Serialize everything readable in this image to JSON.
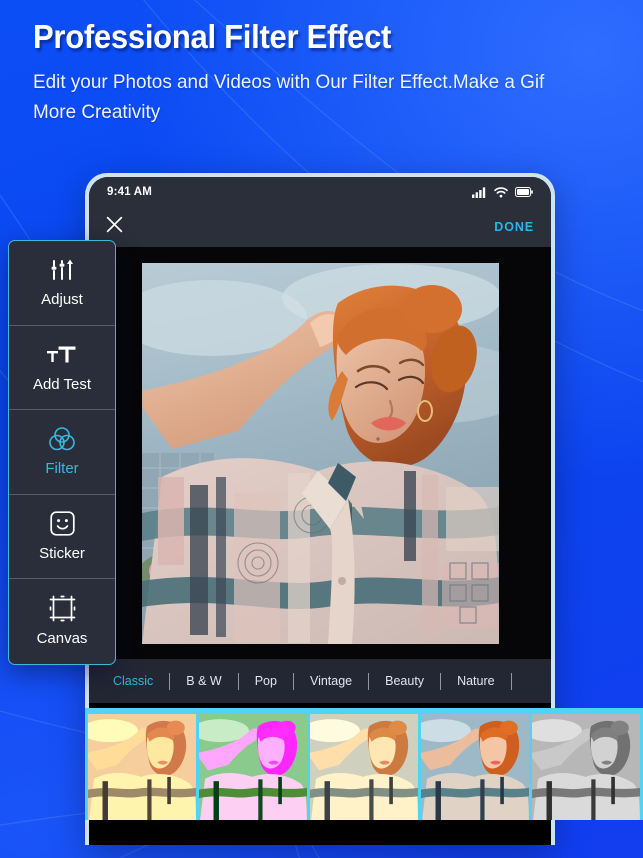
{
  "promo": {
    "title": "Professional Filter Effect",
    "subtitle": "Edit your Photos and Videos with Our Filter Effect.Make a Gif More Creativity",
    "background_color": "#0b4df5",
    "accent_color": "#51d3f5"
  },
  "phone": {
    "status_bar": {
      "time": "9:41 AM",
      "icons": [
        "cellular-signal-icon",
        "wifi-icon",
        "battery-icon"
      ]
    },
    "top_bar": {
      "close_icon": "close-icon",
      "done_label": "DONE"
    }
  },
  "tools": {
    "items": [
      {
        "label": "Adjust",
        "icon": "sliders-icon",
        "active": false
      },
      {
        "label": "Add Test",
        "icon": "text-icon",
        "active": false
      },
      {
        "label": "Filter",
        "icon": "venn-circles-icon",
        "active": true
      },
      {
        "label": "Sticker",
        "icon": "smiley-sticker-icon",
        "active": false
      },
      {
        "label": "Canvas",
        "icon": "crop-frame-icon",
        "active": false
      }
    ],
    "active_color": "#35b9e0"
  },
  "filters": {
    "categories": [
      {
        "label": "Classic",
        "active": true
      },
      {
        "label": "B & W",
        "active": false
      },
      {
        "label": "Pop",
        "active": false
      },
      {
        "label": "Vintage",
        "active": false
      },
      {
        "label": "Beauty",
        "active": false
      },
      {
        "label": "Nature",
        "active": false
      }
    ],
    "active_color": "#2fb6e4",
    "thumbnails": [
      {
        "name": "golden-warm-filter",
        "selected": true
      },
      {
        "name": "magenta-pop-filter",
        "selected": false
      },
      {
        "name": "soft-sepia-filter",
        "selected": false
      },
      {
        "name": "natural-filter",
        "selected": false
      },
      {
        "name": "black-and-white-filter",
        "selected": false
      }
    ]
  },
  "photo": {
    "subject": "woman-with-red-hair-portrait"
  }
}
